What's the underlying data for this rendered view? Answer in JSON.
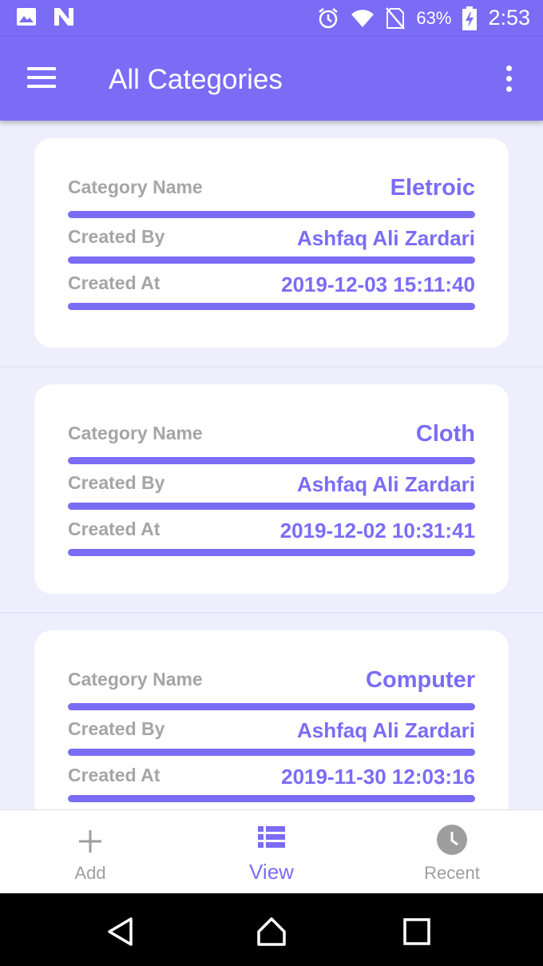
{
  "status_bar": {
    "battery_text": "63%",
    "time": "2:53",
    "icons": [
      "image-icon",
      "n-notification-icon",
      "alarm-icon",
      "wifi-icon",
      "no-sim-icon",
      "battery-charging-icon"
    ]
  },
  "app_bar": {
    "title": "All Categories",
    "icons": [
      "menu-icon",
      "more-vert-icon"
    ]
  },
  "cards": [
    {
      "category_label": "Category Name",
      "category_value": "Eletroic",
      "created_by_label": "Created By",
      "created_by_value": "Ashfaq Ali Zardari",
      "created_at_label": "Created At",
      "created_at_value": "2019-12-03 15:11:40"
    },
    {
      "category_label": "Category Name",
      "category_value": "Cloth",
      "created_by_label": "Created By",
      "created_by_value": "Ashfaq Ali Zardari",
      "created_at_label": "Created At",
      "created_at_value": "2019-12-02 10:31:41"
    },
    {
      "category_label": "Category Name",
      "category_value": "Computer",
      "created_by_label": "Created By",
      "created_by_value": "Ashfaq Ali Zardari",
      "created_at_label": "Created At",
      "created_at_value": "2019-11-30 12:03:16"
    }
  ],
  "bottom_nav": {
    "items": [
      {
        "label": "Add",
        "icon": "plus-icon",
        "active": false
      },
      {
        "label": "View",
        "icon": "list-icon",
        "active": true
      },
      {
        "label": "Recent",
        "icon": "clock-icon",
        "active": false
      }
    ]
  },
  "system_nav": {
    "icons": [
      "back-icon",
      "home-icon",
      "recents-icon"
    ]
  },
  "colors": {
    "accent": "#7b6cf6",
    "label_gray": "#a5a5a5",
    "background": "#efeefc",
    "inactive_nav": "#9e9e9e"
  }
}
